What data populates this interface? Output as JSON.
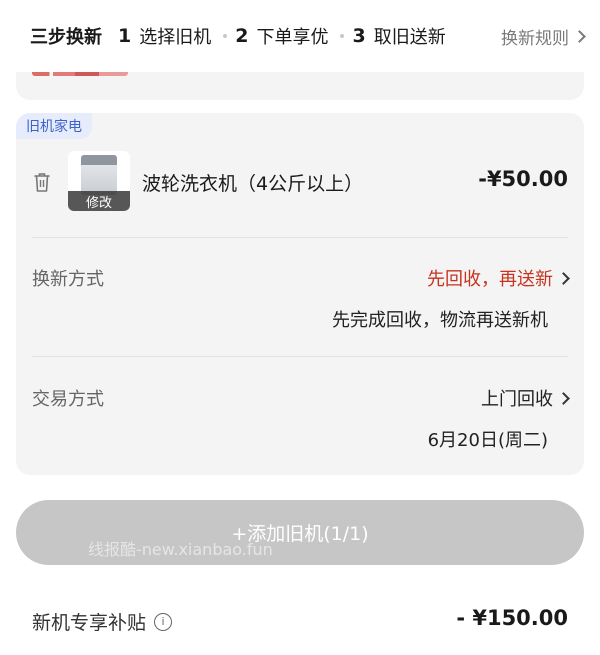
{
  "header": {
    "title": "三步换新",
    "steps": [
      {
        "num": "1",
        "label": "选择旧机"
      },
      {
        "num": "2",
        "label": "下单享优"
      },
      {
        "num": "3",
        "label": "取旧送新"
      }
    ],
    "rules_label": "换新规则"
  },
  "old_appliance": {
    "tag": "旧机家电",
    "name": "波轮洗衣机（4公斤以上）",
    "price": "-¥50.00",
    "modify_label": "修改",
    "exchange_method_label": "换新方式",
    "exchange_method_value": "先回收，再送新",
    "exchange_method_desc": "先完成回收，物流再送新机",
    "trade_method_label": "交易方式",
    "trade_method_value": "上门回收",
    "trade_date": "6月20日(周二)"
  },
  "add_button": {
    "label": "+添加旧机(1/1)"
  },
  "watermark": "线报酷-new.xianbao.fun",
  "subsidy": {
    "label": "新机专享补贴",
    "info_icon": "i",
    "value": "- ¥150.00"
  },
  "colors": {
    "accent_red": "#c8321e",
    "tag_blue": "#3d63c8",
    "button_gray": "#c6c6c6"
  }
}
